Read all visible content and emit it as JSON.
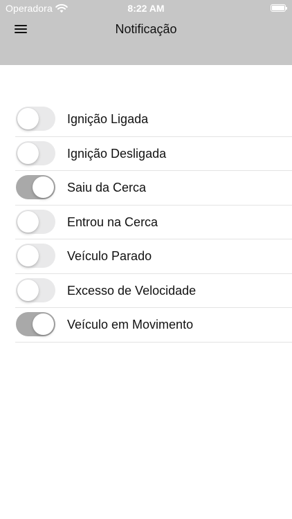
{
  "status_bar": {
    "carrier": "Operadora",
    "time": "8:22 AM"
  },
  "nav": {
    "title": "Notificação"
  },
  "settings": [
    {
      "label": "Ignição Ligada",
      "enabled": false
    },
    {
      "label": "Ignição Desligada",
      "enabled": false
    },
    {
      "label": "Saiu da Cerca",
      "enabled": true
    },
    {
      "label": "Entrou na Cerca",
      "enabled": false
    },
    {
      "label": "Veículo Parado",
      "enabled": false
    },
    {
      "label": "Excesso de Velocidade",
      "enabled": false
    },
    {
      "label": "Veículo em Movimento",
      "enabled": true
    }
  ],
  "icons": {
    "menu": "hamburger-menu-icon",
    "wifi": "wifi-icon",
    "battery": "battery-icon"
  },
  "colors": {
    "header_bg": "#c6c6c6",
    "toggle_on": "#a9a9a9",
    "toggle_off": "#e9e9ea"
  }
}
